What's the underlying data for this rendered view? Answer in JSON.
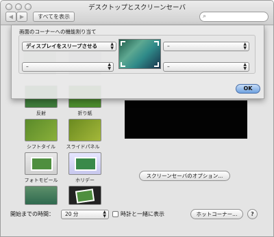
{
  "window": {
    "title": "デスクトップとスクリーンセーバ"
  },
  "toolbar": {
    "back_label": "◀",
    "forward_label": "▶",
    "show_all_label": "すべてを表示",
    "search_placeholder": ""
  },
  "screensavers": [
    {
      "label": "反射",
      "color": "#3d7a3a"
    },
    {
      "label": "折り紙",
      "color": "#4a8a2c"
    },
    {
      "label": "シフトタイル",
      "color": "#6a9a2a"
    },
    {
      "label": "スライドパネル",
      "color": "#7a9a30"
    },
    {
      "label": "フォトモビール",
      "color": "#4f8f3f"
    },
    {
      "label": "ホリデー",
      "color": "#3a8a4a"
    }
  ],
  "options_button": "スクリーンセーバのオプション...",
  "bottom": {
    "start_label": "開始までの時間：",
    "start_value": "20 分",
    "clock_label": "時計と一緒に表示",
    "hot_corners_label": "ホットコーナー..."
  },
  "hot_corners_sheet": {
    "title": "画面のコーナーへの機能割り当て",
    "top_left": "ディスプレイをスリープさせる",
    "top_right": "–",
    "bottom_left": "–",
    "bottom_right": "–",
    "ok_label": "OK"
  }
}
